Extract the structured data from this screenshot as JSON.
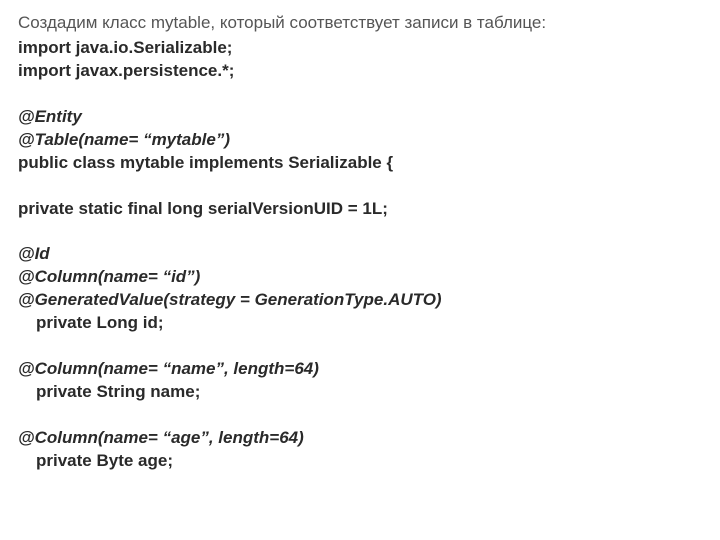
{
  "intro": "Создадим класс mytable, который соответствует записи в таблице:",
  "lines": [
    {
      "text": "import java.io.Serializable;",
      "italic": false,
      "indent": false
    },
    {
      "text": "import javax.persistence.*;",
      "italic": false,
      "indent": false
    },
    {
      "text": "",
      "italic": false,
      "indent": false
    },
    {
      "text": "@Entity",
      "italic": true,
      "indent": false
    },
    {
      "text": "@Table(name= “mytable”)",
      "italic": true,
      "indent": false
    },
    {
      "text": "public class mytable implements Serializable {",
      "italic": false,
      "indent": false
    },
    {
      "text": "",
      "italic": false,
      "indent": false
    },
    {
      "text": "private static final long serialVersionUID = 1L;",
      "italic": false,
      "indent": false
    },
    {
      "text": "",
      "italic": false,
      "indent": false
    },
    {
      "text": "@Id",
      "italic": true,
      "indent": false
    },
    {
      "text": "@Column(name= “id”)",
      "italic": true,
      "indent": false
    },
    {
      "text": "@GeneratedValue(strategy = GenerationType.AUTO)",
      "italic": true,
      "indent": false
    },
    {
      "text": "private Long id;",
      "italic": false,
      "indent": true
    },
    {
      "text": "",
      "italic": false,
      "indent": false
    },
    {
      "text": "@Column(name= “name”, length=64)",
      "italic": true,
      "indent": false
    },
    {
      "text": "private String name;",
      "italic": false,
      "indent": true
    },
    {
      "text": "",
      "italic": false,
      "indent": false
    },
    {
      "text": "@Column(name= “age”, length=64)",
      "italic": true,
      "indent": false
    },
    {
      "text": "private Byte age;",
      "italic": false,
      "indent": true
    }
  ]
}
